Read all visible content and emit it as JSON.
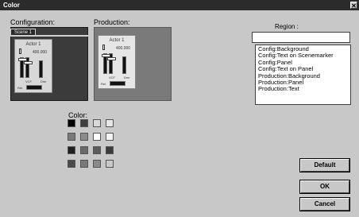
{
  "window": {
    "title": "Color",
    "close_glyph": "✕"
  },
  "configuration": {
    "label": "Configuration:",
    "tab_label": "Scene 1",
    "actor_title": "Actor 1",
    "actor_value": "400.000",
    "fader_label_1": "VCF",
    "fader_label_2": "Dmr",
    "slider_label": "Rel."
  },
  "production": {
    "label": "Production:",
    "actor_title": "Actor 1",
    "actor_value": "400.000",
    "fader_label_1": "VCF",
    "fader_label_2": "Dmr",
    "slider_label": "Rel."
  },
  "region": {
    "label": "Region :",
    "input_value": "",
    "items": [
      "Config:Background",
      "Config:Text on Scenemarker",
      "Config:Panel",
      "Config:Text on Panel",
      "Production:Background",
      "Production:Panel",
      "Production:Text"
    ]
  },
  "color": {
    "label": "Color:",
    "swatches": [
      [
        "#000000",
        "#3f3f3f",
        "#d8d8d8",
        "#e6e6e6"
      ],
      [
        "#7a7a7a",
        "#8c8c8c",
        "#ffffff",
        "#f4f4f4"
      ],
      [
        "#202020",
        "#6a6a6a",
        "#5c5c5c",
        "#3a3a3a"
      ],
      [
        "#4a4a4a",
        "#787878",
        "#8a8a8a",
        "#c8c8c8"
      ]
    ]
  },
  "buttons": {
    "default": "Default",
    "ok": "OK",
    "cancel": "Cancel"
  }
}
